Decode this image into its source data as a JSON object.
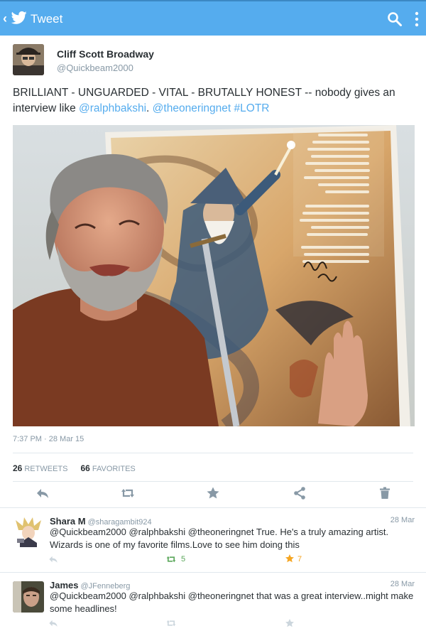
{
  "header": {
    "title": "Tweet",
    "back_glyph": "‹",
    "logo": "twitter-bird-icon",
    "color": "#55acee"
  },
  "tweet": {
    "author_name": "Cliff Scott Broadway",
    "author_handle": "@Quickbeam2000",
    "text_plain": "BRILLIANT - UNGUARDED - VITAL - BRUTALLY HONEST -- nobody gives an interview like ",
    "mention1": "@ralphbakshi",
    "sep": ". ",
    "mention2": "@theoneringnet",
    "space": " ",
    "hashtag": "#LOTR",
    "timestamp": "7:37 PM · 28 Mar 15",
    "retweets_count": "26",
    "retweets_label": "RETWEETS",
    "favorites_count": "66",
    "favorites_label": "FAVORITES",
    "poster_text": "a lingering spell of awe and wonder, of magical innocence overcoming evil, of simple courage conquering fear. He gave us the legend that will live forever in our minds. J.R.R. Tolkien triumphed with the perception that a single dream is more powerful than a thousand realities. Come to Middle-earth, a world beyond the furthest reaches of your imagination.",
    "poster_signature": "Ralph Bakshi"
  },
  "replies": [
    {
      "name": "Shara M",
      "handle": "@sharagambit924",
      "date": "28 Mar",
      "text": "@Quickbeam2000 @ralphbakshi @theoneringnet True. He's a truly amazing artist. Wizards is one of my favorite films.Love to see him doing this",
      "retweets": "5",
      "favorites": "7"
    },
    {
      "name": "James",
      "handle": "@JFenneberg",
      "date": "28 Mar",
      "text": "@Quickbeam2000 @ralphbakshi @theoneringnet that was a great interview..might make some headlines!"
    }
  ]
}
